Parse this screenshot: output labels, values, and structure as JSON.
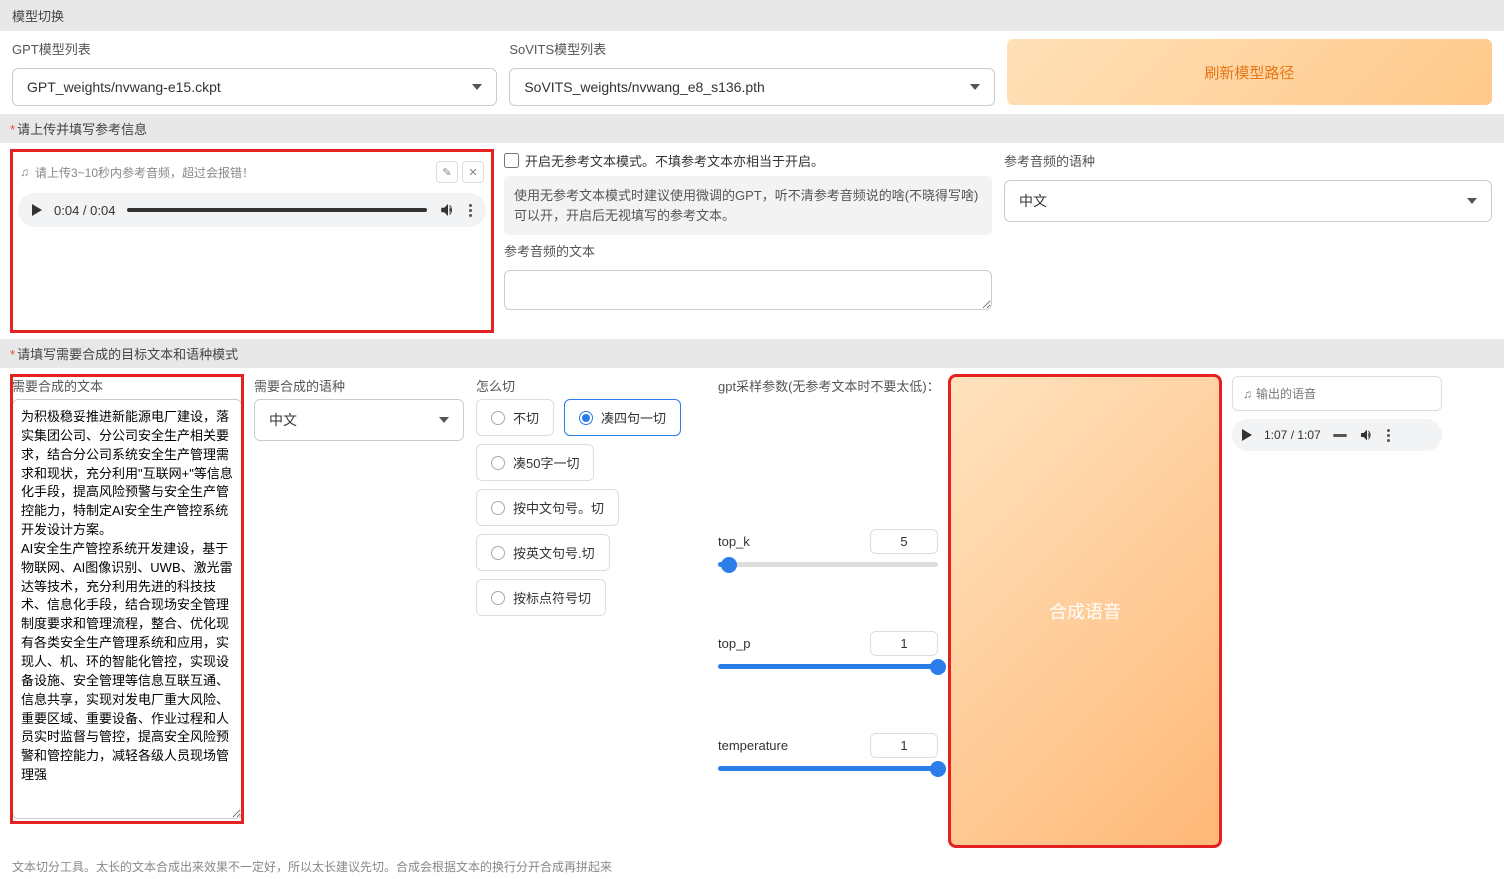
{
  "sections": {
    "model_switch": "模型切换",
    "ref_info": "请上传并填写参考信息",
    "target_text": "请填写需要合成的目标文本和语种模式"
  },
  "gpt": {
    "label": "GPT模型列表",
    "value": "GPT_weights/nvwang-e15.ckpt"
  },
  "sovits": {
    "label": "SoVITS模型列表",
    "value": "SoVITS_weights/nvwang_e8_s136.pth"
  },
  "refresh_btn": "刷新模型路径",
  "upload_hint": "请上传3~10秒内参考音频，超过会报错！",
  "audio_in": {
    "time": "0:04 / 0:04",
    "fill": "100%"
  },
  "no_ref_chk": "开启无参考文本模式。不填参考文本亦相当于开启。",
  "no_ref_note": "使用无参考文本模式时建议使用微调的GPT，听不清参考音频说的啥(不晓得写啥)可以开，开启后无视填写的参考文本。",
  "ref_text": {
    "label": "参考音频的文本"
  },
  "ref_lang": {
    "label": "参考音频的语种",
    "value": "中文"
  },
  "syn_text": {
    "label": "需要合成的文本",
    "value": "为积极稳妥推进新能源电厂建设，落实集团公司、分公司安全生产相关要求，结合分公司系统安全生产管理需求和现状，充分利用\"互联网+\"等信息化手段，提高风险预警与安全生产管控能力，特制定AI安全生产管控系统开发设计方案。\nAI安全生产管控系统开发建设，基于物联网、AI图像识别、UWB、激光雷达等技术，充分利用先进的科技技术、信息化手段，结合现场安全管理制度要求和管理流程，整合、优化现有各类安全生产管理系统和应用，实现人、机、环的智能化管控，实现设备设施、安全管理等信息互联互通、信息共享，实现对发电厂重大风险、重要区域、重要设备、作业过程和人员实时监督与管控，提高安全风险预警和管控能力，减轻各级人员现场管理强"
  },
  "syn_lang": {
    "label": "需要合成的语种",
    "value": "中文"
  },
  "cut": {
    "label": "怎么切",
    "o1": "不切",
    "o2": "凑四句一切",
    "o3": "凑50字一切",
    "o4": "按中文句号。切",
    "o5": "按英文句号.切",
    "o6": "按标点符号切"
  },
  "sampling_label": "gpt采样参数(无参考文本时不要太低)：",
  "top_k": {
    "label": "top_k",
    "value": "5",
    "fill": "5%"
  },
  "top_p": {
    "label": "top_p",
    "value": "1",
    "fill": "100%"
  },
  "temp": {
    "label": "temperature",
    "value": "1",
    "fill": "100%"
  },
  "syn_btn": "合成语音",
  "out_audio": {
    "label": "输出的语音",
    "time": "1:07 / 1:07"
  },
  "footer_note": "文本切分工具。太长的文本合成出来效果不一定好，所以太长建议先切。合成会根据文本的换行分开合成再拼起来"
}
